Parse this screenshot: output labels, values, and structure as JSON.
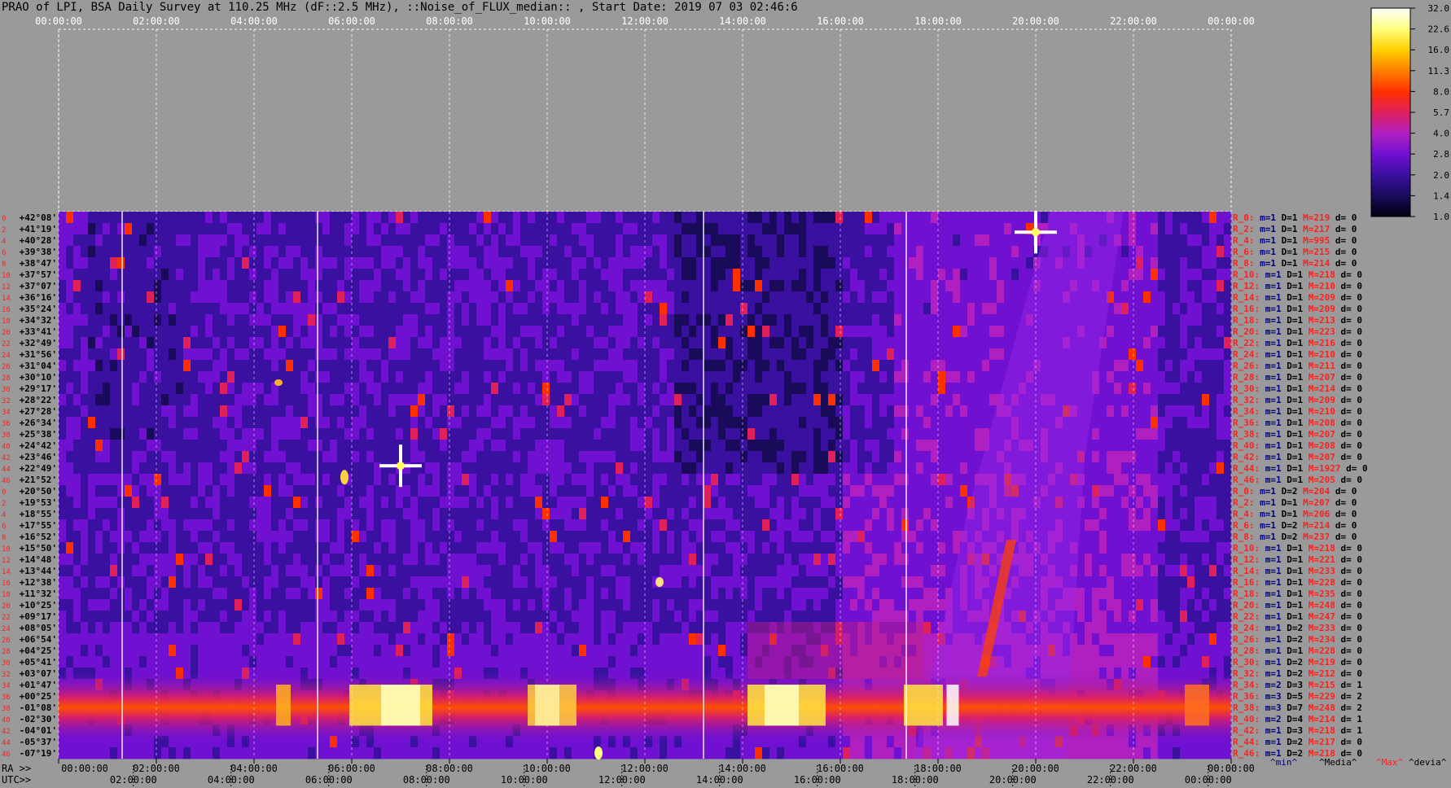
{
  "title": "PRAO of LPI, BSA Daily Survey at 110.25 MHz (dF::2.5 MHz), ::Noise_of_FLUX_median:: , Start Date: 2019 07 03 02:46:6",
  "chart_data": {
    "type": "heatmap",
    "title": "PRAO of LPI, BSA Daily Survey at 110.25 MHz (dF::2.5 MHz), ::Noise_of_FLUX_median:: , Start Date: 2019 07 03 02:46:6",
    "x_top_ticks": [
      "00:00:00",
      "02:00:00",
      "04:00:00",
      "06:00:00",
      "08:00:00",
      "10:00:00",
      "12:00:00",
      "14:00:00",
      "16:00:00",
      "18:00:00",
      "20:00:00",
      "22:00:00",
      "00:00:00"
    ],
    "x_ra_label": "RA >>",
    "x_ra_ticks": [
      "00:00:00",
      "02:00:00",
      "04:00:00",
      "06:00:00",
      "08:00:00",
      "10:00:00",
      "12:00:00",
      "14:00:00",
      "16:00:00",
      "18:00:00",
      "20:00:00",
      "22:00:00",
      "00:00:00"
    ],
    "x_utc_label": "UTC>>",
    "x_utc_ticks": [
      "04:00:00",
      "06:00:00",
      "08:00:00",
      "10:00:00",
      "12:00:00",
      "14:00:00",
      "16:00:00",
      "18:00:00",
      "20:00:00",
      "22:00:00",
      "00:00:00",
      "02:00:00"
    ],
    "row_numbers": [
      "0",
      "2",
      "4",
      "6",
      "8",
      "10",
      "12",
      "14",
      "16",
      "18",
      "20",
      "22",
      "24",
      "26",
      "28",
      "30",
      "32",
      "34",
      "36",
      "38",
      "40",
      "42",
      "44",
      "46",
      "0",
      "2",
      "4",
      "6",
      "8",
      "10",
      "12",
      "14",
      "16",
      "18",
      "20",
      "22",
      "24",
      "26",
      "28",
      "30",
      "32",
      "34",
      "36",
      "38",
      "40",
      "42",
      "44",
      "46"
    ],
    "declinations": [
      "+42°08'",
      "+41°19'",
      "+40°28'",
      "+39°38'",
      "+38°47'",
      "+37°57'",
      "+37°07'",
      "+36°16'",
      "+35°24'",
      "+34°32'",
      "+33°41'",
      "+32°49'",
      "+31°56'",
      "+31°04'",
      "+30°10'",
      "+29°17'",
      "+28°22'",
      "+27°28'",
      "+26°34'",
      "+25°38'",
      "+24°42'",
      "+23°46'",
      "+22°49'",
      "+21°52'",
      "+20°50'",
      "+19°53'",
      "+18°55'",
      "+17°55'",
      "+16°52'",
      "+15°50'",
      "+14°48'",
      "+13°44'",
      "+12°38'",
      "+11°32'",
      "+10°25'",
      "+09°17'",
      "+08°05'",
      "+06°54'",
      "+04°25'",
      "+05°41'",
      "+03°07'",
      "+01°47'",
      "+00°25'",
      "-01°08'",
      "-02°30'",
      "-04°01'",
      "-05°37'",
      "-07°19'"
    ],
    "channel_stats": [
      [
        "R_0:",
        "m=1",
        "D=1",
        "M=219",
        "d= 0"
      ],
      [
        "R_2:",
        "m=1",
        "D=1",
        "M=217",
        "d= 0"
      ],
      [
        "R_4:",
        "m=1",
        "D=1",
        "M=995",
        "d= 0"
      ],
      [
        "R_6:",
        "m=1",
        "D=1",
        "M=215",
        "d= 0"
      ],
      [
        "R_8:",
        "m=1",
        "D=1",
        "M=214",
        "d= 0"
      ],
      [
        "R_10:",
        "m=1",
        "D=1",
        "M=218",
        "d= 0"
      ],
      [
        "R_12:",
        "m=1",
        "D=1",
        "M=210",
        "d= 0"
      ],
      [
        "R_14:",
        "m=1",
        "D=1",
        "M=209",
        "d= 0"
      ],
      [
        "R_16:",
        "m=1",
        "D=1",
        "M=209",
        "d= 0"
      ],
      [
        "R_18:",
        "m=1",
        "D=1",
        "M=213",
        "d= 0"
      ],
      [
        "R_20:",
        "m=1",
        "D=1",
        "M=223",
        "d= 0"
      ],
      [
        "R_22:",
        "m=1",
        "D=1",
        "M=216",
        "d= 0"
      ],
      [
        "R_24:",
        "m=1",
        "D=1",
        "M=210",
        "d= 0"
      ],
      [
        "R_26:",
        "m=1",
        "D=1",
        "M=211",
        "d= 0"
      ],
      [
        "R_28:",
        "m=1",
        "D=1",
        "M=207",
        "d= 0"
      ],
      [
        "R_30:",
        "m=1",
        "D=1",
        "M=214",
        "d= 0"
      ],
      [
        "R_32:",
        "m=1",
        "D=1",
        "M=209",
        "d= 0"
      ],
      [
        "R_34:",
        "m=1",
        "D=1",
        "M=210",
        "d= 0"
      ],
      [
        "R_36:",
        "m=1",
        "D=1",
        "M=208",
        "d= 0"
      ],
      [
        "R_38:",
        "m=1",
        "D=1",
        "M=207",
        "d= 0"
      ],
      [
        "R_40:",
        "m=1",
        "D=1",
        "M=208",
        "d= 0"
      ],
      [
        "R_42:",
        "m=1",
        "D=1",
        "M=207",
        "d= 0"
      ],
      [
        "R_44:",
        "m=1",
        "D=1",
        "M=1927",
        "d= 0"
      ],
      [
        "R_46:",
        "m=1",
        "D=1",
        "M=205",
        "d= 0"
      ],
      [
        "R_0:",
        "m=1",
        "D=2",
        "M=204",
        "d= 0"
      ],
      [
        "R_2:",
        "m=1",
        "D=1",
        "M=207",
        "d= 0"
      ],
      [
        "R_4:",
        "m=1",
        "D=1",
        "M=206",
        "d= 0"
      ],
      [
        "R_6:",
        "m=1",
        "D=2",
        "M=214",
        "d= 0"
      ],
      [
        "R_8:",
        "m=1",
        "D=2",
        "M=237",
        "d= 0"
      ],
      [
        "R_10:",
        "m=1",
        "D=1",
        "M=218",
        "d= 0"
      ],
      [
        "R_12:",
        "m=1",
        "D=1",
        "M=221",
        "d= 0"
      ],
      [
        "R_14:",
        "m=1",
        "D=1",
        "M=233",
        "d= 0"
      ],
      [
        "R_16:",
        "m=1",
        "D=1",
        "M=228",
        "d= 0"
      ],
      [
        "R_18:",
        "m=1",
        "D=1",
        "M=235",
        "d= 0"
      ],
      [
        "R_20:",
        "m=1",
        "D=1",
        "M=248",
        "d= 0"
      ],
      [
        "R_22:",
        "m=1",
        "D=1",
        "M=247",
        "d= 0"
      ],
      [
        "R_24:",
        "m=1",
        "D=2",
        "M=233",
        "d= 0"
      ],
      [
        "R_26:",
        "m=1",
        "D=2",
        "M=234",
        "d= 0"
      ],
      [
        "R_28:",
        "m=1",
        "D=1",
        "M=228",
        "d= 0"
      ],
      [
        "R_30:",
        "m=1",
        "D=2",
        "M=219",
        "d= 0"
      ],
      [
        "R_32:",
        "m=1",
        "D=2",
        "M=212",
        "d= 0"
      ],
      [
        "R_34:",
        "m=2",
        "D=3",
        "M=215",
        "d= 1"
      ],
      [
        "R_36:",
        "m=3",
        "D=5",
        "M=229",
        "d= 2"
      ],
      [
        "R_38:",
        "m=3",
        "D=7",
        "M=248",
        "d= 2"
      ],
      [
        "R_40:",
        "m=2",
        "D=4",
        "M=214",
        "d= 1"
      ],
      [
        "R_42:",
        "m=1",
        "D=3",
        "M=218",
        "d= 1"
      ],
      [
        "R_44:",
        "m=1",
        "D=2",
        "M=217",
        "d= 0"
      ],
      [
        "R_46:",
        "m=1",
        "D=2",
        "M=218",
        "d= 0"
      ]
    ],
    "stat_headers": [
      "^min^",
      "^Media^",
      "^Max^",
      "^devia^"
    ],
    "colorbar_ticks": [
      "32.0",
      "22.6",
      "16.0",
      "11.3",
      "8.0",
      "5.7",
      "4.0",
      "2.8",
      "2.0",
      "1.4",
      "1.0"
    ],
    "colorbar_range": [
      1.0,
      32.0
    ],
    "colorbar_scale": "log",
    "colormap": [
      "#000010",
      "#1a0a5a",
      "#3a10a0",
      "#7010d0",
      "#b020c0",
      "#e0205a",
      "#ff3000",
      "#ff8000",
      "#ffd000",
      "#ffff80",
      "#ffffff"
    ],
    "bright_sources": [
      {
        "ra": "20:00",
        "dec": "+41°19'"
      },
      {
        "ra": "07:00",
        "dec": "+22°49'"
      },
      {
        "ra": "05:50",
        "dec": "+21°52'"
      },
      {
        "ra": "12:20",
        "dec": "+12°38'"
      },
      {
        "ra": "11:00",
        "dec": "-07°19'"
      }
    ]
  }
}
